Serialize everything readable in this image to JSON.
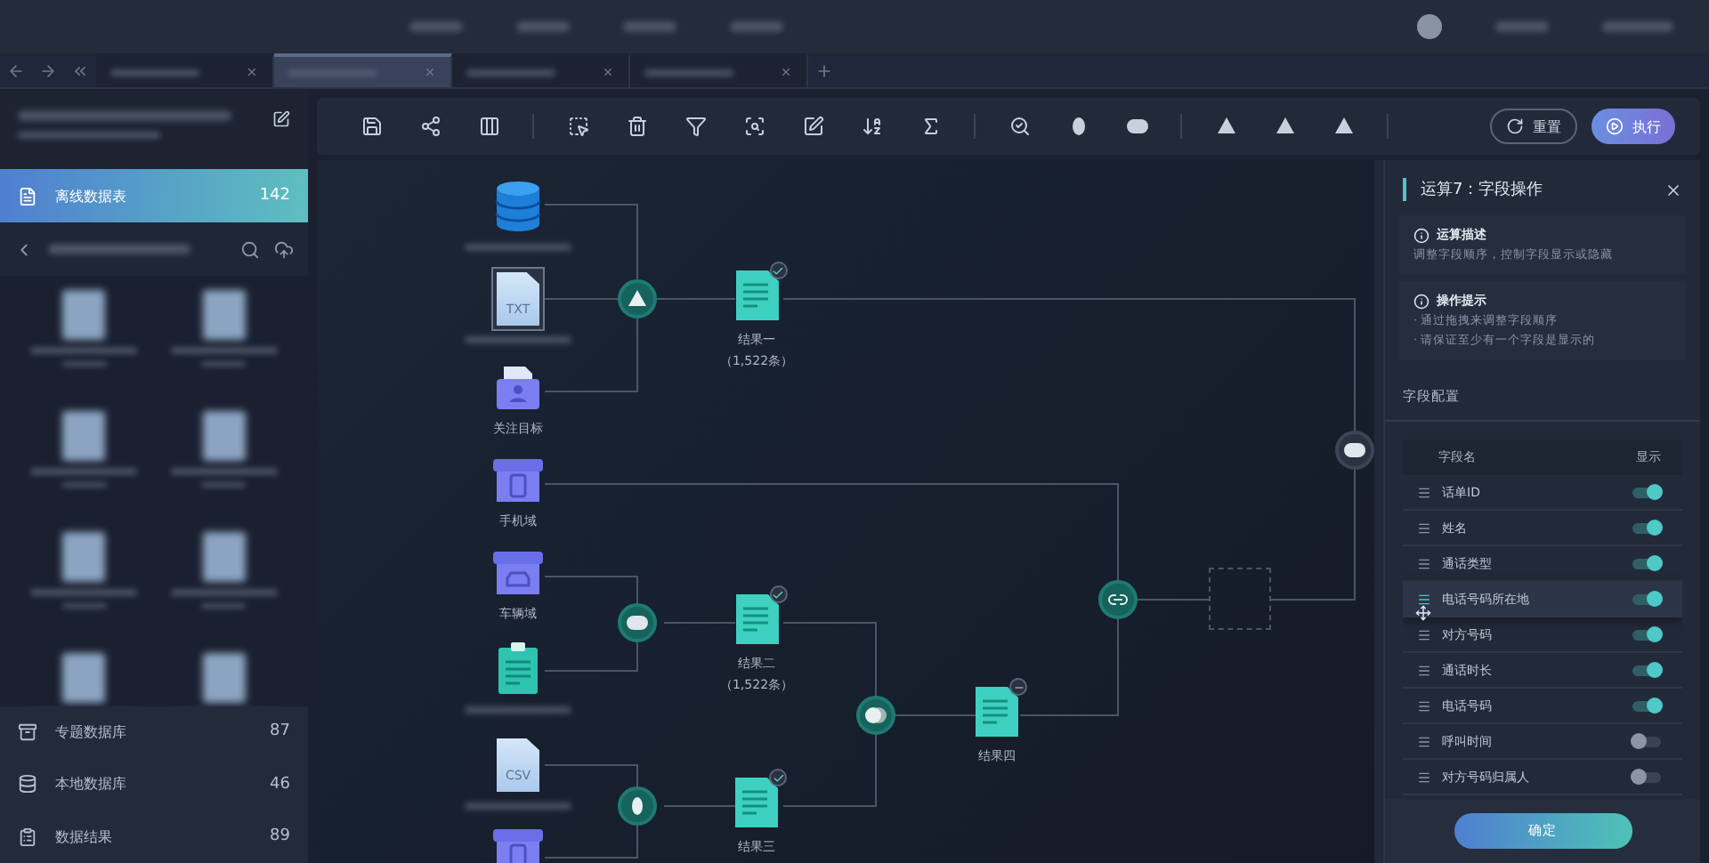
{
  "top_tabs": [
    {
      "selected": false
    },
    {
      "selected": true
    },
    {
      "selected": false
    },
    {
      "selected": false
    }
  ],
  "sidebar": {
    "active_item": {
      "label": "离线数据表",
      "count": "142",
      "selected": true
    },
    "items": [
      {
        "label": "专题数据库",
        "count": "87",
        "kind": "archive"
      },
      {
        "label": "本地数据库",
        "count": "46",
        "kind": "database"
      },
      {
        "label": "数据结果",
        "count": "89",
        "kind": "clipboard"
      }
    ]
  },
  "toolbar": {
    "buttons": [
      {
        "label": "重置",
        "kind": "outline"
      },
      {
        "label": "执行",
        "kind": "primary"
      }
    ]
  },
  "canvas": {
    "sources": [
      {
        "kind": "database",
        "selected": false
      },
      {
        "kind": "file",
        "file_type": "TXT",
        "selected": true
      },
      {
        "kind": "folder",
        "label": "关注目标",
        "selected": false
      },
      {
        "kind": "phone-box",
        "label": "手机域",
        "selected": false
      },
      {
        "kind": "car-box",
        "label": "车辆域",
        "selected": false
      },
      {
        "kind": "clipboard",
        "selected": false
      },
      {
        "kind": "file",
        "file_type": "CSV",
        "selected": false
      },
      {
        "kind": "phone-box",
        "selected": false
      }
    ],
    "results": [
      {
        "title": "结果一",
        "count": "（1,522条）",
        "kind": "done"
      },
      {
        "title": "结果二",
        "count": "（1,522条）",
        "kind": "done"
      },
      {
        "title": "结果三",
        "kind": "done"
      },
      {
        "title": "结果四",
        "kind": "pending"
      }
    ],
    "operators": [
      {
        "kind": "intersect",
        "active": true
      },
      {
        "kind": "union",
        "active": true
      },
      {
        "kind": "diff",
        "active": true
      },
      {
        "kind": "merge",
        "active": true
      },
      {
        "kind": "link",
        "active": true
      },
      {
        "kind": "union",
        "active": false
      }
    ]
  },
  "panel": {
    "title": "运算7：字段操作",
    "description": {
      "title": "运算描述",
      "text": "调整字段顺序，控制字段显示或隐藏"
    },
    "tips": {
      "title": "操作提示",
      "lines": [
        "· 通过拖拽来调整字段顺序",
        "· 请保证至少有一个字段是显示的"
      ]
    },
    "section_title": "字段配置",
    "columns": [
      "字段名",
      "显示"
    ],
    "fields": [
      {
        "name": "话单ID",
        "on": true,
        "dragging": false
      },
      {
        "name": "姓名",
        "on": true,
        "dragging": false
      },
      {
        "name": "通话类型",
        "on": true,
        "dragging": false
      },
      {
        "name": "电话号码所在地",
        "on": true,
        "dragging": true
      },
      {
        "name": "对方号码",
        "on": true,
        "dragging": false
      },
      {
        "name": "通话时长",
        "on": true,
        "dragging": false
      },
      {
        "name": "电话号码",
        "on": true,
        "dragging": false
      },
      {
        "name": "呼叫时间",
        "on": false,
        "dragging": false
      },
      {
        "name": "对方号码归属人",
        "on": false,
        "dragging": false
      }
    ],
    "confirm": "确定"
  }
}
